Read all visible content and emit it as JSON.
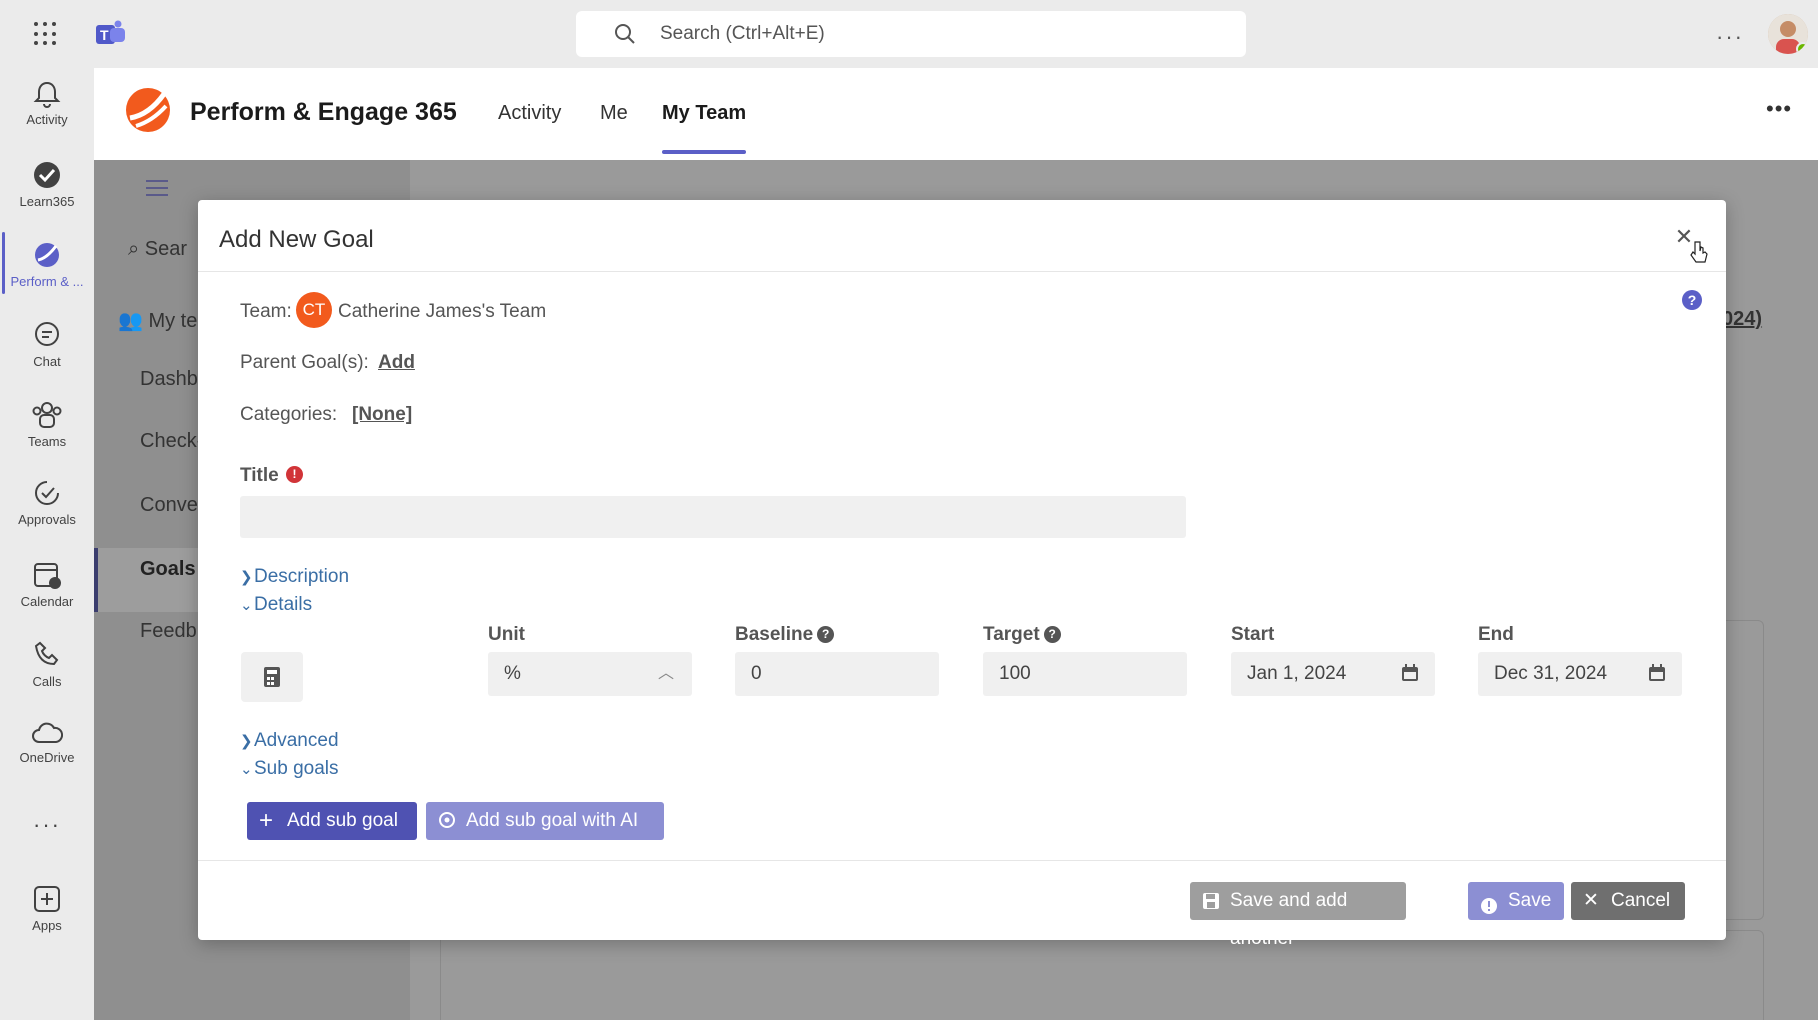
{
  "topbar": {
    "search_placeholder": "Search (Ctrl+Alt+E)"
  },
  "rail": {
    "items": [
      {
        "label": "Activity",
        "icon": "bell-icon"
      },
      {
        "label": "Learn365",
        "icon": "check-circle-icon"
      },
      {
        "label": "Perform & ...",
        "icon": "perform-icon"
      },
      {
        "label": "Chat",
        "icon": "chat-icon"
      },
      {
        "label": "Teams",
        "icon": "teams-icon"
      },
      {
        "label": "Approvals",
        "icon": "approvals-icon"
      },
      {
        "label": "Calendar",
        "icon": "calendar-icon"
      },
      {
        "label": "Calls",
        "icon": "phone-icon"
      },
      {
        "label": "OneDrive",
        "icon": "cloud-icon"
      },
      {
        "label": "Apps",
        "icon": "apps-plus-icon"
      }
    ]
  },
  "app": {
    "title": "Perform & Engage 365",
    "tabs": [
      {
        "label": "Activity"
      },
      {
        "label": "Me"
      },
      {
        "label": "My Team",
        "active": true
      }
    ]
  },
  "background": {
    "search_partial": "Sear",
    "my_team_partial": "My te",
    "nav": [
      "Dashb",
      "Check-",
      "Conve",
      "Goals",
      "Feedb"
    ],
    "right_partial": "024)"
  },
  "modal": {
    "title": "Add New Goal",
    "team_label": "Team:",
    "team_initials": "CT",
    "team_name": "Catherine James's Team",
    "parent_label": "Parent Goal(s):",
    "parent_link": "Add",
    "categories_label": "Categories:",
    "categories_link": "[None]",
    "title_label": "Title",
    "title_value": "",
    "sections": {
      "description": "Description",
      "details": "Details",
      "advanced": "Advanced",
      "sub_goals": "Sub goals"
    },
    "details": {
      "unit_label": "Unit",
      "unit_value": "%",
      "baseline_label": "Baseline",
      "baseline_value": "0",
      "target_label": "Target",
      "target_value": "100",
      "start_label": "Start",
      "start_value": "Jan 1, 2024",
      "end_label": "End",
      "end_value": "Dec 31, 2024"
    },
    "buttons": {
      "add_sub_goal": "Add sub goal",
      "add_sub_goal_ai": "Add sub goal with AI",
      "save_and_add": "Save and add another",
      "save": "Save",
      "cancel": "Cancel"
    }
  },
  "colors": {
    "accent": "#5b5fc7",
    "primary_button": "#4f52b2",
    "required": "#d13438",
    "team_avatar": "#f25a1d"
  }
}
